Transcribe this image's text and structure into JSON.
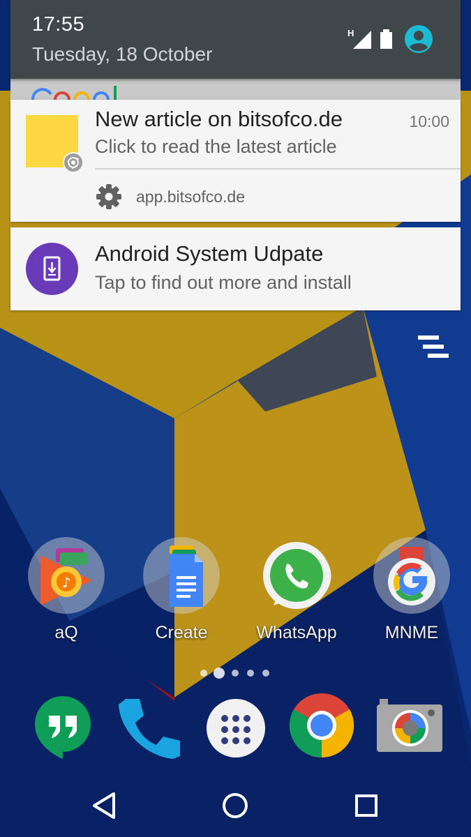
{
  "status": {
    "time": "17:55",
    "date": "Tuesday, 18 October",
    "network_type": "H"
  },
  "notifications": [
    {
      "title": "New article on bitsofco.de",
      "text": "Click to read the latest article",
      "time": "10:00",
      "thumbnail_color": "#fed843",
      "badge_icon": "chrome-icon",
      "action_icon": "gear-icon",
      "action_label": "app.bitsofco.de"
    },
    {
      "title": "Android System Udpate",
      "text": "Tap to find out more and install",
      "icon": "system-update-icon",
      "icon_color": "#6a3bb8"
    }
  ],
  "home": {
    "apps": [
      {
        "label": "aQ",
        "icon": "play-music-folder-icon"
      },
      {
        "label": "Create",
        "icon": "docs-folder-icon"
      },
      {
        "label": "WhatsApp",
        "icon": "whatsapp-icon"
      },
      {
        "label": "MNME",
        "icon": "google-folder-icon"
      }
    ],
    "page_count": 5,
    "current_page": 2,
    "dock": [
      {
        "icon": "hangouts-icon"
      },
      {
        "icon": "phone-icon"
      },
      {
        "icon": "app-drawer-icon"
      },
      {
        "icon": "chrome-icon"
      },
      {
        "icon": "camera-icon"
      }
    ]
  },
  "colors": {
    "shade_header": "#3f474b",
    "notification_bg": "#f5f5f5",
    "wallpaper_blue": "#0a2d86",
    "wallpaper_yellow": "#e1b21a",
    "wallpaper_red": "#c51919",
    "accent_teal": "#19bcd3"
  }
}
